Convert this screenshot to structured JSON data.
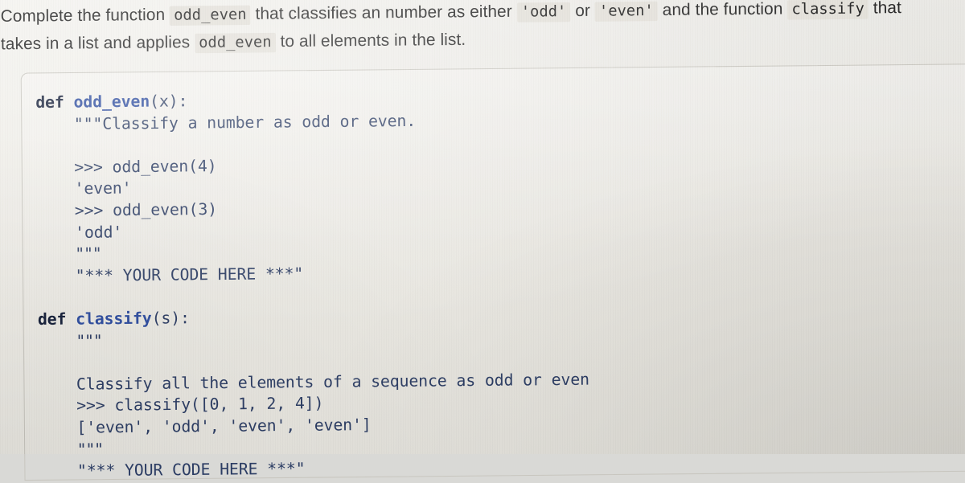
{
  "prompt": {
    "line1_part1": "Complete the function",
    "line1_code1": "odd_even",
    "line1_part2": "that classifies an number as either",
    "line1_code2": "'odd'",
    "line1_part3": "or",
    "line1_code3": "'even'",
    "line1_part4": "and the function",
    "line1_code4": "classify",
    "line1_part5": "that",
    "line2_part1": "takes in a list and applies",
    "line2_code1": "odd_even",
    "line2_part2": "to all elements in the list."
  },
  "code": {
    "lines": [
      "def odd_even(x):",
      "    \"\"\"Classify a number as odd or even.",
      "",
      "    >>> odd_even(4)",
      "    'even'",
      "    >>> odd_even(3)",
      "    'odd'",
      "    \"\"\"",
      "    \"*** YOUR CODE HERE ***\"",
      "",
      "def classify(s):",
      "    \"\"\"",
      "",
      "    Classify all the elements of a sequence as odd or even",
      "    >>> classify([0, 1, 2, 4])",
      "    ['even', 'odd', 'even', 'even']",
      "    \"\"\"",
      "    \"*** YOUR CODE HERE ***\""
    ],
    "def_keyword": "def",
    "function_names": [
      "odd_even",
      "classify"
    ]
  },
  "colors": {
    "code_text": "#2b3c63",
    "keyword": "#16203a",
    "function_name": "#2f4ea0",
    "prompt_text": "#242424",
    "inline_code_bg": "#e3e0d9",
    "card_border": "#c8c6bf",
    "page_bg": "#eeece6"
  }
}
